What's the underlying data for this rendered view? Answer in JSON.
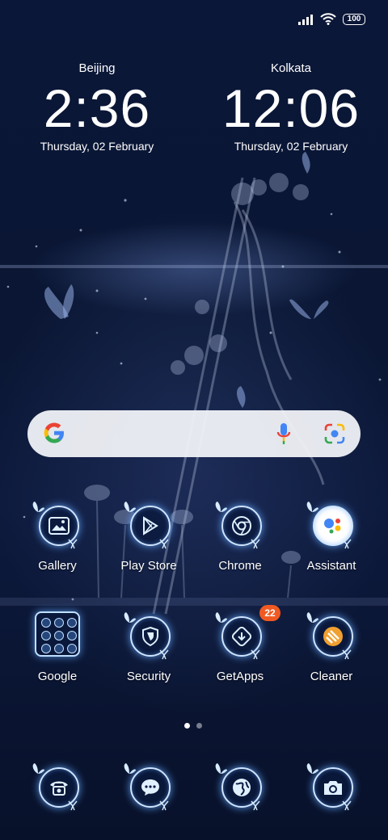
{
  "status_bar": {
    "signal_icon": "signal-bars-icon",
    "wifi_icon": "wifi-icon",
    "battery_level": "100"
  },
  "clocks": [
    {
      "city": "Beijing",
      "time": "2:36",
      "date": "Thursday, 02 February"
    },
    {
      "city": "Kolkata",
      "time": "12:06",
      "date": "Thursday, 02 February"
    }
  ],
  "search_bar": {
    "google_icon": "google-g-icon",
    "mic_icon": "microphone-icon",
    "lens_icon": "camera-lens-icon"
  },
  "apps_row1": [
    {
      "label": "Gallery",
      "icon": "gallery-icon"
    },
    {
      "label": "Play Store",
      "icon": "play-store-icon"
    },
    {
      "label": "Chrome",
      "icon": "chrome-icon"
    },
    {
      "label": "Assistant",
      "icon": "assistant-icon"
    }
  ],
  "apps_row2": [
    {
      "label": "Google",
      "icon": "folder-icon"
    },
    {
      "label": "Security",
      "icon": "shield-icon"
    },
    {
      "label": "GetApps",
      "icon": "getapps-icon",
      "badge": "22"
    },
    {
      "label": "Cleaner",
      "icon": "cleaner-icon"
    }
  ],
  "dock": [
    {
      "icon": "phone-icon"
    },
    {
      "icon": "messages-icon"
    },
    {
      "icon": "browser-globe-icon"
    },
    {
      "icon": "camera-icon"
    }
  ],
  "page_indicator": {
    "pages": 2,
    "active_page": 1
  },
  "colors": {
    "background": "#0b1738",
    "icon_glow": "#64aaff",
    "badge": "#f05a22"
  }
}
